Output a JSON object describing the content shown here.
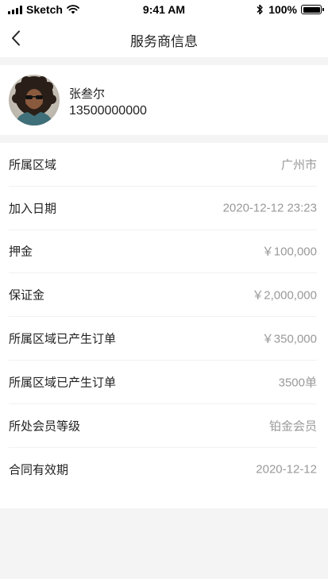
{
  "status_bar": {
    "carrier": "Sketch",
    "time": "9:41 AM",
    "battery_percent": "100%",
    "battery_level": 1.0
  },
  "nav": {
    "back_icon": "chevron-left-icon",
    "title": "服务商信息"
  },
  "profile": {
    "avatar": "avatar-photo",
    "name": "张叁尔",
    "phone": "13500000000"
  },
  "info_rows": [
    {
      "label": "所属区域",
      "value": "广州市"
    },
    {
      "label": "加入日期",
      "value": "2020-12-12 23:23"
    },
    {
      "label": "押金",
      "value": "￥100,000"
    },
    {
      "label": "保证金",
      "value": "￥2,000,000"
    },
    {
      "label": "所属区域已产生订单",
      "value": "￥350,000"
    },
    {
      "label": "所属区域已产生订单",
      "value": "3500单"
    },
    {
      "label": "所处会员等级",
      "value": "铂金会员"
    },
    {
      "label": "合同有效期",
      "value": "2020-12-12"
    }
  ],
  "colors": {
    "background": "#f4f4f4",
    "card": "#ffffff",
    "text_primary": "#222222",
    "text_secondary": "#999999"
  }
}
